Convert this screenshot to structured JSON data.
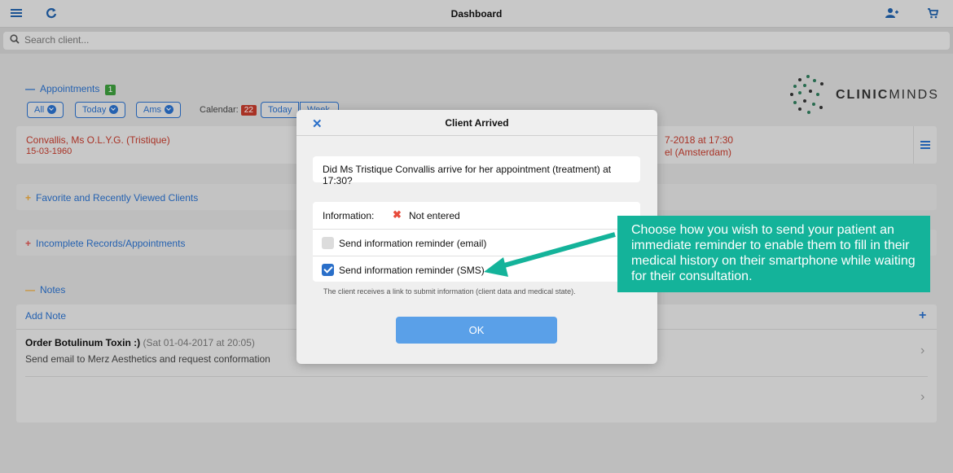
{
  "header": {
    "title": "Dashboard",
    "icons": [
      "menu-icon",
      "refresh-icon",
      "add-user-icon",
      "cart-icon"
    ]
  },
  "search": {
    "placeholder": "Search client..."
  },
  "appointments": {
    "label": "Appointments",
    "count": "1",
    "filters": [
      "All",
      "Today",
      "Ams"
    ],
    "calendar_label": "Calendar:",
    "calendar_count": "22",
    "calendar_buttons": [
      "Today",
      "Week"
    ],
    "entry": {
      "name": "Convallis, Ms O.L.Y.G. (Tristique)",
      "dob": "15-03-1960",
      "datetime_fragment": "7-2018 at 17:30",
      "location_fragment": "el (Amsterdam)"
    }
  },
  "sections": {
    "favorites": "Favorite and Recently Viewed Clients",
    "incomplete": "Incomplete Records/Appointments",
    "notes": "Notes"
  },
  "notes": {
    "add_label": "Add Note",
    "items": [
      {
        "title": "Order Botulinum Toxin :)",
        "date": "(Sat 01-04-2017 at 20:05)",
        "body": "Send email to Merz Aesthetics and request conformation"
      }
    ]
  },
  "logo": {
    "text_bold": "CLINIC",
    "text_light": "MINDS"
  },
  "modal": {
    "title": "Client Arrived",
    "question": "Did Ms Tristique Convallis arrive for her appointment (treatment) at 17:30?",
    "info_label": "Information:",
    "info_status": "Not entered",
    "option_email": "Send information reminder (email)",
    "option_sms": "Send information reminder (SMS)",
    "option_email_checked": false,
    "option_sms_checked": true,
    "helper": "The client receives a link to submit information (client data and medical state).",
    "ok_label": "OK"
  },
  "callout": {
    "text": "Choose how you wish to send your patient an immediate reminder to enable them to fill in their medical history on their smartphone while waiting for their consultation."
  },
  "colors": {
    "accent": "#2a6fc9",
    "callout": "#14b39a",
    "alert_red": "#c0392b",
    "success_green": "#3c9a3c"
  }
}
